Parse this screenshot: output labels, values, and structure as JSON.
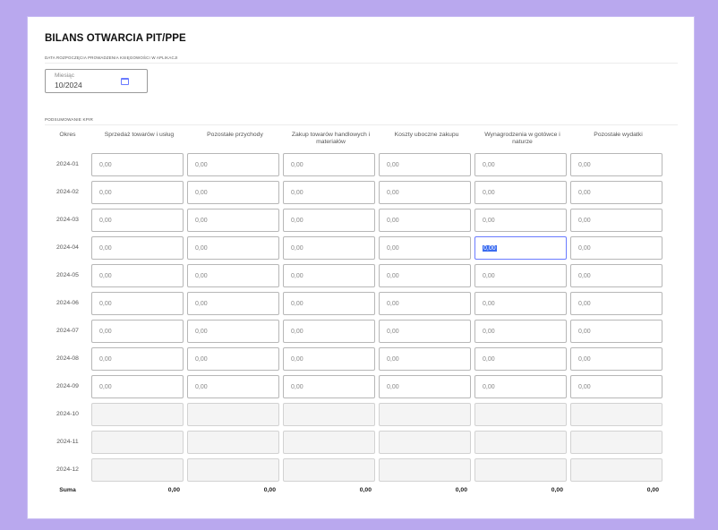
{
  "header": {
    "title": "BILANS OTWARCIA PIT/PPE",
    "subtitle": "DATA ROZPOCZĘCIA PROWADZENIA KSIĘGOWOŚCI W APLIKACJI"
  },
  "month_field": {
    "label": "Miesiąc",
    "value": "10/2024",
    "icon": "calendar-icon"
  },
  "section": {
    "title": "PODSUMOWANIE KPIR"
  },
  "table": {
    "okres_header": "Okres",
    "columns": [
      "Sprzedaż towarów i usług",
      "Pozostałe przychody",
      "Zakup towarów handlowych i materiałów",
      "Koszty uboczne zakupu",
      "Wynagrodzenia w gotówce i naturze",
      "Pozostałe wydatki"
    ],
    "rows": [
      {
        "period": "2024-01",
        "values": [
          "0,00",
          "0,00",
          "0,00",
          "0,00",
          "0,00",
          "0,00"
        ],
        "disabled": false
      },
      {
        "period": "2024-02",
        "values": [
          "0,00",
          "0,00",
          "0,00",
          "0,00",
          "0,00",
          "0,00"
        ],
        "disabled": false
      },
      {
        "period": "2024-03",
        "values": [
          "0,00",
          "0,00",
          "0,00",
          "0,00",
          "0,00",
          "0,00"
        ],
        "disabled": false
      },
      {
        "period": "2024-04",
        "values": [
          "0,00",
          "0,00",
          "0,00",
          "0,00",
          "0,00",
          "0,00"
        ],
        "disabled": false
      },
      {
        "period": "2024-05",
        "values": [
          "0,00",
          "0,00",
          "0,00",
          "0,00",
          "0,00",
          "0,00"
        ],
        "disabled": false
      },
      {
        "period": "2024-06",
        "values": [
          "0,00",
          "0,00",
          "0,00",
          "0,00",
          "0,00",
          "0,00"
        ],
        "disabled": false
      },
      {
        "period": "2024-07",
        "values": [
          "0,00",
          "0,00",
          "0,00",
          "0,00",
          "0,00",
          "0,00"
        ],
        "disabled": false
      },
      {
        "period": "2024-08",
        "values": [
          "0,00",
          "0,00",
          "0,00",
          "0,00",
          "0,00",
          "0,00"
        ],
        "disabled": false
      },
      {
        "period": "2024-09",
        "values": [
          "0,00",
          "0,00",
          "0,00",
          "0,00",
          "0,00",
          "0,00"
        ],
        "disabled": false
      },
      {
        "period": "2024-10",
        "values": [
          "",
          "",
          "",
          "",
          "",
          ""
        ],
        "disabled": true
      },
      {
        "period": "2024-11",
        "values": [
          "",
          "",
          "",
          "",
          "",
          ""
        ],
        "disabled": true
      },
      {
        "period": "2024-12",
        "values": [
          "",
          "",
          "",
          "",
          "",
          ""
        ],
        "disabled": true
      }
    ],
    "focused_cell": {
      "row": 3,
      "col": 4
    },
    "sum_label": "Suma",
    "sums": [
      "0,00",
      "0,00",
      "0,00",
      "0,00",
      "0,00",
      "0,00"
    ]
  },
  "colors": {
    "background": "#b9a8ee",
    "accent": "#6a7bff",
    "selection": "#3b6cf0"
  }
}
